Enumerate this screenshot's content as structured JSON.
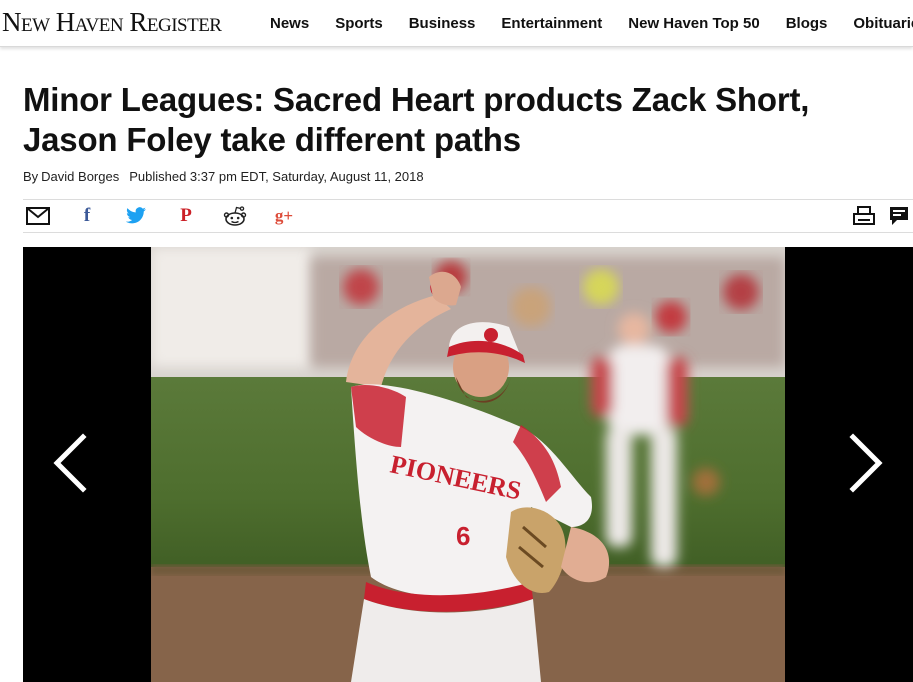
{
  "header": {
    "masthead": "New Haven Register",
    "nav": [
      "News",
      "Sports",
      "Business",
      "Entertainment",
      "New Haven Top 50",
      "Blogs",
      "Obituaries"
    ]
  },
  "article": {
    "headline": "Minor Leagues: Sacred Heart products Zack Short, Jason Foley take different paths",
    "byline_prefix": "By",
    "author": "David Borges",
    "published": "Published 3:37 pm EDT, Saturday, August 11, 2018"
  },
  "share": {
    "icons": [
      "email-icon",
      "facebook-icon",
      "twitter-icon",
      "pinterest-icon",
      "reddit-icon",
      "google-plus-icon",
      "print-icon",
      "comment-icon"
    ],
    "facebook_glyph": "f",
    "pinterest_glyph": "P",
    "google_glyph": "g+"
  },
  "gallery": {
    "jersey_text": "PIONEERS",
    "jersey_number": "6"
  },
  "colors": {
    "facebook": "#3b5998",
    "twitter": "#1da1f2",
    "pinterest": "#cb2027",
    "google": "#dd4b39",
    "jersey_red": "#c8202f"
  }
}
